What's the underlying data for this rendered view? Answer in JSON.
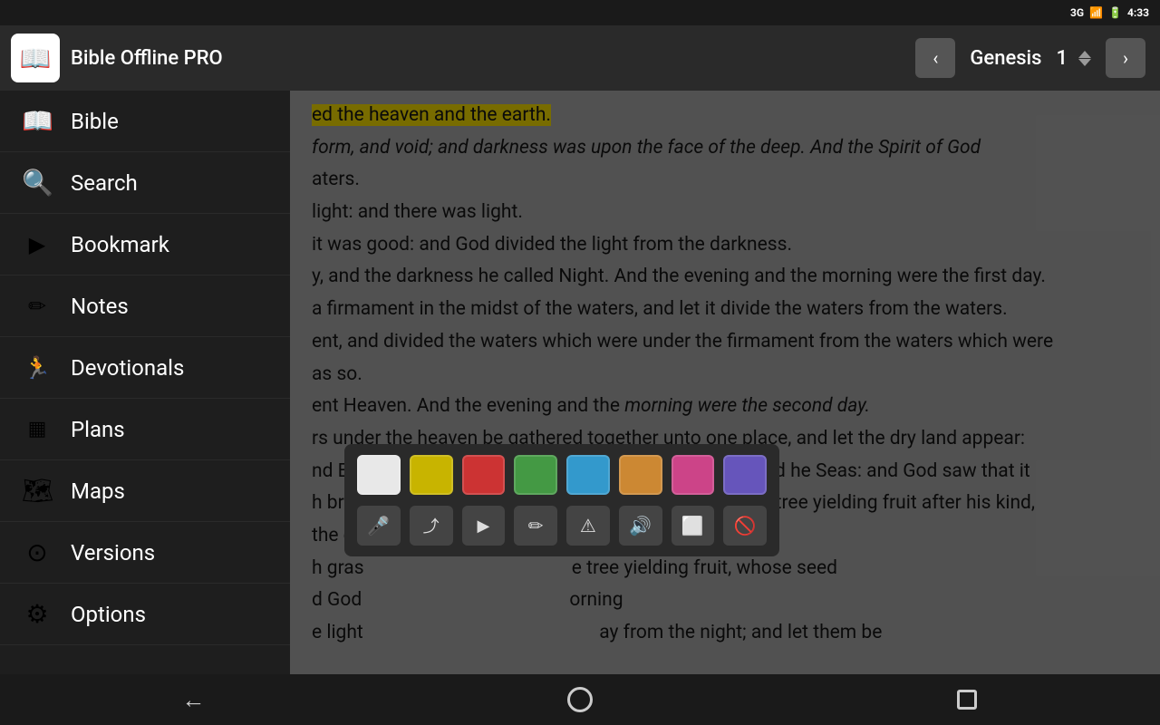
{
  "statusBar": {
    "network": "3G",
    "time": "4:33",
    "batteryIcon": "🔋"
  },
  "header": {
    "appTitle": "Bible Offline PRO",
    "logoIcon": "📖",
    "chapterLabel": "Genesis",
    "chapterNum": "1",
    "prevIcon": "‹",
    "nextIcon": "›"
  },
  "sidebar": {
    "items": [
      {
        "id": "bible",
        "label": "Bible",
        "icon": "📖"
      },
      {
        "id": "search",
        "label": "Search",
        "icon": "🔍"
      },
      {
        "id": "bookmark",
        "label": "Bookmark",
        "icon": "▶"
      },
      {
        "id": "notes",
        "label": "Notes",
        "icon": "✏"
      },
      {
        "id": "devotionals",
        "label": "Devotionals",
        "icon": "🏃"
      },
      {
        "id": "plans",
        "label": "Plans",
        "icon": "▦"
      },
      {
        "id": "maps",
        "label": "Maps",
        "icon": "🗺"
      },
      {
        "id": "versions",
        "label": "Versions",
        "icon": "⊙"
      },
      {
        "id": "options",
        "label": "Options",
        "icon": "⚙"
      }
    ]
  },
  "bibleText": {
    "lines": [
      "ed the heaven and the earth.",
      "form, and void; and darkness was upon the face of the deep. And the Spirit of God",
      "aters.",
      "light: and there was light.",
      "it was good: and God divided the light from the darkness.",
      "y, and the darkness he called Night. And the evening and the morning were the first day.",
      "a firmament in the midst of the waters, and let it divide the waters from the waters.",
      "ent, and divided the waters which were under the firmament from the waters which were",
      "as so.",
      "ent Heaven. And the evening and the morning were the second day.",
      "rs under the heaven be gathered together unto one place, and let the dry land appear:",
      "nd Earth; and the gathering together of the waters called he Seas: and God saw that it",
      "h bring forth grass, the herb yielding seed, and the fruit tree yielding fruit after his kind,",
      "the earth: and it was so.",
      "h gras                                              e tree yielding fruit, whose seed",
      "d God                                               orning",
      "e light                                                            ay from the night; and let them be"
    ]
  },
  "colorPicker": {
    "colors": [
      {
        "id": "white",
        "hex": "#e8e8e8"
      },
      {
        "id": "yellow",
        "hex": "#c8b400"
      },
      {
        "id": "red",
        "hex": "#cc3333"
      },
      {
        "id": "green",
        "hex": "#449944"
      },
      {
        "id": "blue",
        "hex": "#3399cc"
      },
      {
        "id": "orange",
        "hex": "#cc8833"
      },
      {
        "id": "pink",
        "hex": "#cc4488"
      },
      {
        "id": "purple",
        "hex": "#6655bb"
      }
    ],
    "tools": [
      {
        "id": "mic",
        "icon": "🎤"
      },
      {
        "id": "share",
        "icon": "⤴"
      },
      {
        "id": "play",
        "icon": "▶"
      },
      {
        "id": "edit",
        "icon": "✏"
      },
      {
        "id": "warning",
        "icon": "⚠"
      },
      {
        "id": "volume",
        "icon": "🔊"
      },
      {
        "id": "copy",
        "icon": "⬜"
      },
      {
        "id": "block",
        "icon": "🚫"
      }
    ]
  },
  "bottomBar": {
    "backLabel": "←",
    "homeLabel": "○",
    "recentsLabel": "□"
  }
}
